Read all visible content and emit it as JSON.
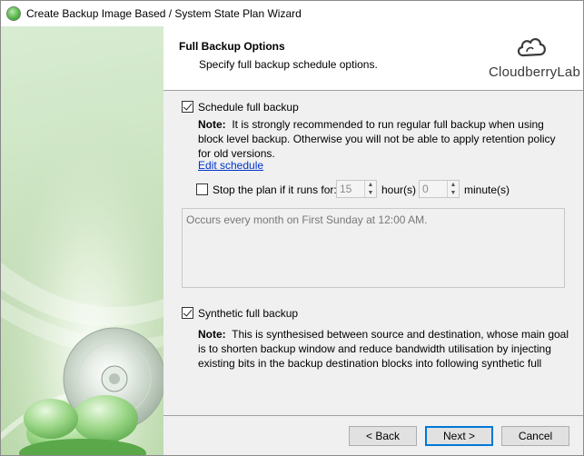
{
  "window": {
    "title": "Create Backup Image Based / System State Plan Wizard"
  },
  "header": {
    "title": "Full Backup Options",
    "subtitle": "Specify full backup schedule options.",
    "logo_text": "CloudberryLab"
  },
  "schedule_full": {
    "label": "Schedule full backup",
    "checked": true,
    "note_label": "Note:",
    "note_text": "It is strongly recommended to run regular full backup when using block level backup. Otherwise you will not be able to apply retention policy for old versions.",
    "edit_link": "Edit schedule"
  },
  "stop_plan": {
    "label": "Stop the plan if it runs for:",
    "checked": false,
    "hours_value": "15",
    "hours_unit": "hour(s)",
    "minutes_value": "0",
    "minutes_unit": "minute(s)"
  },
  "schedule_summary": "Occurs every month on First Sunday at 12:00 AM.",
  "synthetic": {
    "label": "Synthetic full backup",
    "checked": true,
    "note_label": "Note:",
    "note_text": "This is synthesised between source and destination, whose main goal is to shorten backup window and reduce bandwidth utilisation by injecting existing bits in the backup destination blocks into following synthetic full"
  },
  "buttons": {
    "back": "< Back",
    "next": "Next >",
    "cancel": "Cancel"
  },
  "icons": {
    "app": "cloudberry-app-icon",
    "logo": "cloud-logo-icon",
    "sidebar": "disc-cloud-illustration"
  }
}
